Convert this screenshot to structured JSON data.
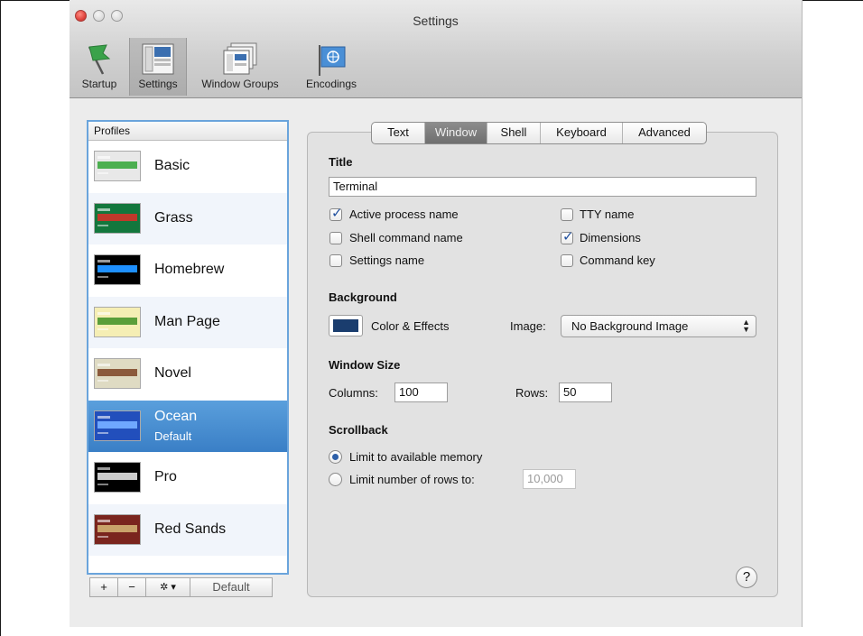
{
  "window": {
    "title": "Settings"
  },
  "toolbar": {
    "items": [
      {
        "label": "Startup",
        "icon": "startup-flag-icon"
      },
      {
        "label": "Settings",
        "icon": "settings-window-icon"
      },
      {
        "label": "Window Groups",
        "icon": "window-groups-icon"
      },
      {
        "label": "Encodings",
        "icon": "encodings-globe-flag-icon"
      }
    ],
    "selected": "Settings"
  },
  "profiles": {
    "header": "Profiles",
    "items": [
      {
        "name": "Basic",
        "sub": "",
        "colors": {
          "bg": "#e8e8e8",
          "accent": "#4caf50"
        }
      },
      {
        "name": "Grass",
        "sub": "",
        "colors": {
          "bg": "#13773d",
          "accent": "#c0392b"
        }
      },
      {
        "name": "Homebrew",
        "sub": "",
        "colors": {
          "bg": "#000000",
          "accent": "#1e90ff"
        }
      },
      {
        "name": "Man Page",
        "sub": "",
        "colors": {
          "bg": "#f5eeb4",
          "accent": "#5a9e3a"
        }
      },
      {
        "name": "Novel",
        "sub": "",
        "colors": {
          "bg": "#dfdbc3",
          "accent": "#8b5a3c"
        }
      },
      {
        "name": "Ocean",
        "sub": "Default",
        "colors": {
          "bg": "#224fbc",
          "accent": "#6fa8ff"
        }
      },
      {
        "name": "Pro",
        "sub": "",
        "colors": {
          "bg": "#000000",
          "accent": "#cccccc"
        }
      },
      {
        "name": "Red Sands",
        "sub": "",
        "colors": {
          "bg": "#7a251e",
          "accent": "#c9a26a"
        }
      }
    ],
    "selected": "Ocean",
    "buttons": {
      "add": "+",
      "remove": "−",
      "gear": "✲ ▾",
      "default": "Default"
    }
  },
  "tabs": {
    "items": [
      "Text",
      "Window",
      "Shell",
      "Keyboard",
      "Advanced"
    ],
    "active": "Window"
  },
  "window_tab": {
    "title_heading": "Title",
    "title_value": "Terminal",
    "checks": {
      "active_process_name": {
        "label": "Active process name",
        "checked": true
      },
      "shell_command_name": {
        "label": "Shell command name",
        "checked": false
      },
      "settings_name": {
        "label": "Settings name",
        "checked": false
      },
      "tty_name": {
        "label": "TTY name",
        "checked": false
      },
      "dimensions": {
        "label": "Dimensions",
        "checked": true
      },
      "command_key": {
        "label": "Command key",
        "checked": false
      }
    },
    "background_heading": "Background",
    "color_effects_label": "Color & Effects",
    "image_label": "Image:",
    "image_value": "No Background Image",
    "window_size_heading": "Window Size",
    "columns_label": "Columns:",
    "columns_value": "100",
    "rows_label": "Rows:",
    "rows_value": "50",
    "scrollback_heading": "Scrollback",
    "limit_memory_label": "Limit to available memory",
    "limit_rows_label": "Limit number of rows to:",
    "limit_rows_value": "10,000",
    "help_label": "?"
  },
  "colors": {
    "swatch": "#1a3d6e",
    "selection": "#3a7fc6",
    "focus_ring": "#6aa4dc"
  }
}
